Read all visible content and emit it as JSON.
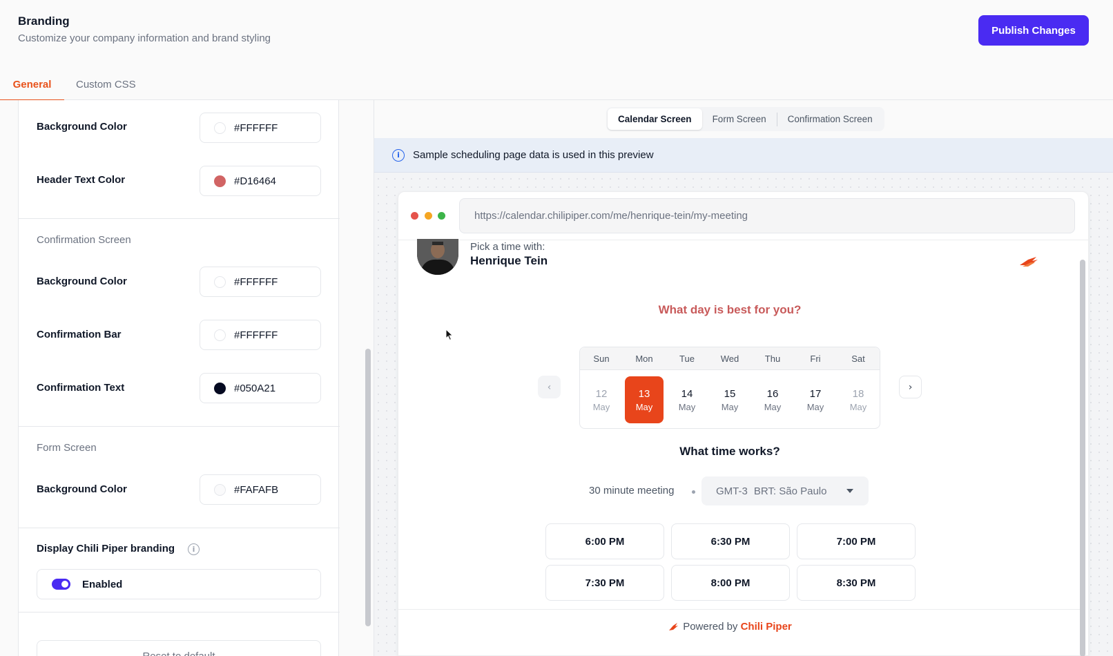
{
  "header": {
    "title": "Branding",
    "subtitle": "Customize your company information and brand styling",
    "publish_label": "Publish Changes"
  },
  "tabs": [
    {
      "label": "General",
      "active": true
    },
    {
      "label": "Custom CSS",
      "active": false
    }
  ],
  "left": {
    "top_section": {
      "rows": [
        {
          "label": "Background Color",
          "hex": "#FFFFFF"
        },
        {
          "label": "Header Text Color",
          "hex": "#D16464"
        }
      ]
    },
    "confirmation_section": {
      "heading": "Confirmation Screen",
      "rows": [
        {
          "label": "Background Color",
          "hex": "#FFFFFF"
        },
        {
          "label": "Confirmation Bar",
          "hex": "#FFFFFF"
        },
        {
          "label": "Confirmation Text",
          "hex": "#050A21"
        }
      ]
    },
    "form_section": {
      "heading": "Form Screen",
      "rows": [
        {
          "label": "Background Color",
          "hex": "#FAFAFB"
        }
      ]
    },
    "branding_section": {
      "label": "Display Chili Piper branding",
      "toggle_label": "Enabled",
      "enabled": true
    },
    "reset_label": "Reset to default"
  },
  "preview": {
    "screens": [
      {
        "label": "Calendar Screen",
        "active": true
      },
      {
        "label": "Form Screen",
        "active": false
      },
      {
        "label": "Confirmation Screen",
        "active": false
      }
    ],
    "banner": "Sample scheduling page data is used in this preview",
    "url": "https://calendar.chilipiper.com/me/henrique-tein/my-meeting",
    "pick_label": "Pick a time with:",
    "host_name": "Henrique Tein",
    "day_question": "What day is best for you?",
    "time_question": "What time works?",
    "weekdays": [
      "Sun",
      "Mon",
      "Tue",
      "Wed",
      "Thu",
      "Fri",
      "Sat"
    ],
    "days": [
      {
        "day": "12",
        "month": "May",
        "state": "muted"
      },
      {
        "day": "13",
        "month": "May",
        "state": "selected"
      },
      {
        "day": "14",
        "month": "May",
        "state": "normal"
      },
      {
        "day": "15",
        "month": "May",
        "state": "normal"
      },
      {
        "day": "16",
        "month": "May",
        "state": "normal"
      },
      {
        "day": "17",
        "month": "May",
        "state": "normal"
      },
      {
        "day": "18",
        "month": "May",
        "state": "muted"
      }
    ],
    "duration": "30 minute meeting",
    "timezone_code": "GMT-3",
    "timezone_name": "BRT: São Paulo",
    "slots": [
      "6:00 PM",
      "6:30 PM",
      "7:00 PM",
      "7:30 PM",
      "8:00 PM",
      "8:30 PM"
    ],
    "powered_by": "Powered by",
    "powered_brand": "Chili Piper"
  },
  "colors": {
    "accent": "#4A2BF2",
    "brand": "#E8451B",
    "header_text": "#D16464"
  }
}
